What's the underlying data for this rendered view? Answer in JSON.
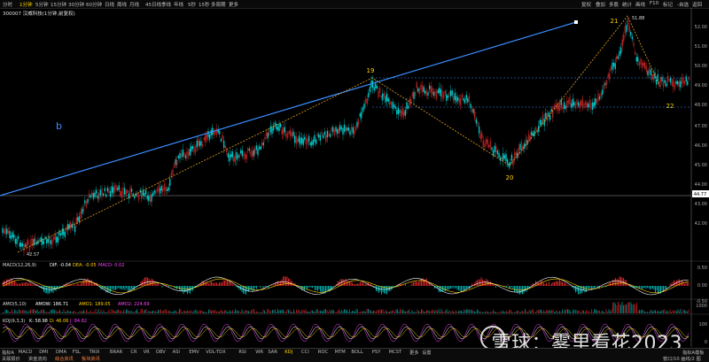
{
  "toolbar": {
    "items": [
      "分时",
      "1分钟",
      "5分钟",
      "15分钟",
      "30分钟",
      "60分钟",
      "日线",
      "周线",
      "月线",
      "45日线",
      "季线",
      "年线",
      "5秒",
      "15秒",
      "多周期",
      "更多"
    ],
    "active_index": 1,
    "right_items": [
      "复权",
      "叠加",
      "多股",
      "统计",
      "画线",
      "F10",
      "标记",
      "-自选",
      "返回"
    ]
  },
  "title": "300007 汉威科技(1分钟,前复权)",
  "annotations": {
    "b": "b",
    "wave19": "19",
    "wave20": "20",
    "wave21": "21",
    "wave22": "22",
    "high": "51.88",
    "low": "42.57"
  },
  "price_axis": [
    "52.00",
    "51.00",
    "50.00",
    "49.00",
    "48.00",
    "47.00",
    "46.00",
    "45.00",
    "44.00",
    "43.00",
    "42.00"
  ],
  "price_marker": "44.77",
  "macd": {
    "name": "MACD(12,26,9)",
    "dif_label": "DIF: -0.04",
    "dea_label": "DEA: -0.05",
    "macd_label": "MACD: 0.02",
    "axis": [
      "0.50",
      "0.00",
      "-0.50"
    ]
  },
  "amo": {
    "name": "AMO(5,10)",
    "amow_label": "AMOW: 186.71",
    "amo1_label": "AMO1: 189.05",
    "amo2_label": "AMO2: 224.69",
    "axis": [
      "1000"
    ]
  },
  "kdj": {
    "name": "KDJ(9,3,3)",
    "k_label": "K: 58.98",
    "d_label": "D: 46.06",
    "j_label": "J: 84.82",
    "axis": [
      "100",
      "0"
    ]
  },
  "bottom_indicators": [
    "指标A",
    "MACD",
    "DMI",
    "DMA",
    "FSL",
    "TRIX",
    "BRAR",
    "CR",
    "VR",
    "OBV",
    "ASI",
    "EMV",
    "VOL-TDX",
    "RSI",
    "WR",
    "SAR",
    "KDJ",
    "CCI",
    "ROC",
    "MTM",
    "BOLL",
    "PSY",
    "MCST",
    "更多",
    "设置"
  ],
  "bottom_active": "KDJ",
  "bottom_tabs": [
    "关联报价",
    "资金流向",
    "综合资讯",
    "板块资讯"
  ],
  "bottom_right": [
    "指标A",
    "模板"
  ],
  "status_right": "窗口/10  画线/2  图",
  "watermark": "雪球：雾里看花2023",
  "colors": {
    "up": "#ff3030",
    "down": "#00d0d0",
    "trend": "#3b8cff",
    "wave": "#e0a020",
    "dif": "#ffffff",
    "dea": "#ffd400",
    "k": "#ffffff",
    "d": "#ffd400",
    "j": "#ff40ff"
  }
}
